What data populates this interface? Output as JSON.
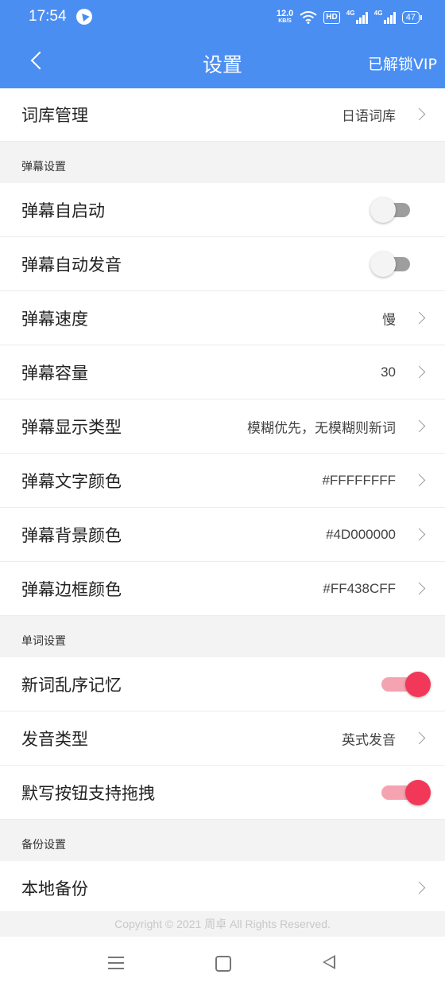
{
  "status_bar": {
    "time": "17:54",
    "net_speed": "12.0",
    "net_speed_unit": "KB/S",
    "hd_badge": "HD",
    "sig1_label": "4G",
    "sig2_label": "4G",
    "battery": "47"
  },
  "header": {
    "title": "设置",
    "vip_label": "已解锁VIP",
    "bg_color": "#4b8ef2"
  },
  "rows": {
    "vocab": {
      "label": "词库管理",
      "value": "日语词库"
    },
    "danmaku_section": "弹幕设置",
    "auto_start": {
      "label": "弹幕自启动",
      "toggle": false
    },
    "auto_speak": {
      "label": "弹幕自动发音",
      "toggle": false
    },
    "speed": {
      "label": "弹幕速度",
      "value": "慢"
    },
    "capacity": {
      "label": "弹幕容量",
      "value": "30"
    },
    "display_type": {
      "label": "弹幕显示类型",
      "value": "模糊优先，无模糊则新词"
    },
    "text_color": {
      "label": "弹幕文字颜色",
      "value": "#FFFFFFFF"
    },
    "bg_color": {
      "label": "弹幕背景颜色",
      "value": "#4D000000"
    },
    "border_color": {
      "label": "弹幕边框颜色",
      "value": "#FF438CFF"
    },
    "word_section": "单词设置",
    "shuffle": {
      "label": "新词乱序记忆",
      "toggle": true
    },
    "pron_type": {
      "label": "发音类型",
      "value": "英式发音"
    },
    "drag": {
      "label": "默写按钮支持拖拽",
      "toggle": true
    },
    "backup_section": "备份设置",
    "local_backup": {
      "label": "本地备份"
    }
  },
  "footer": "Copyright © 2021 周卓 All Rights Reserved.",
  "toggle_on_color": "#f23858",
  "system_nav": {
    "icons": [
      "menu-icon",
      "home-icon",
      "back-icon"
    ]
  }
}
